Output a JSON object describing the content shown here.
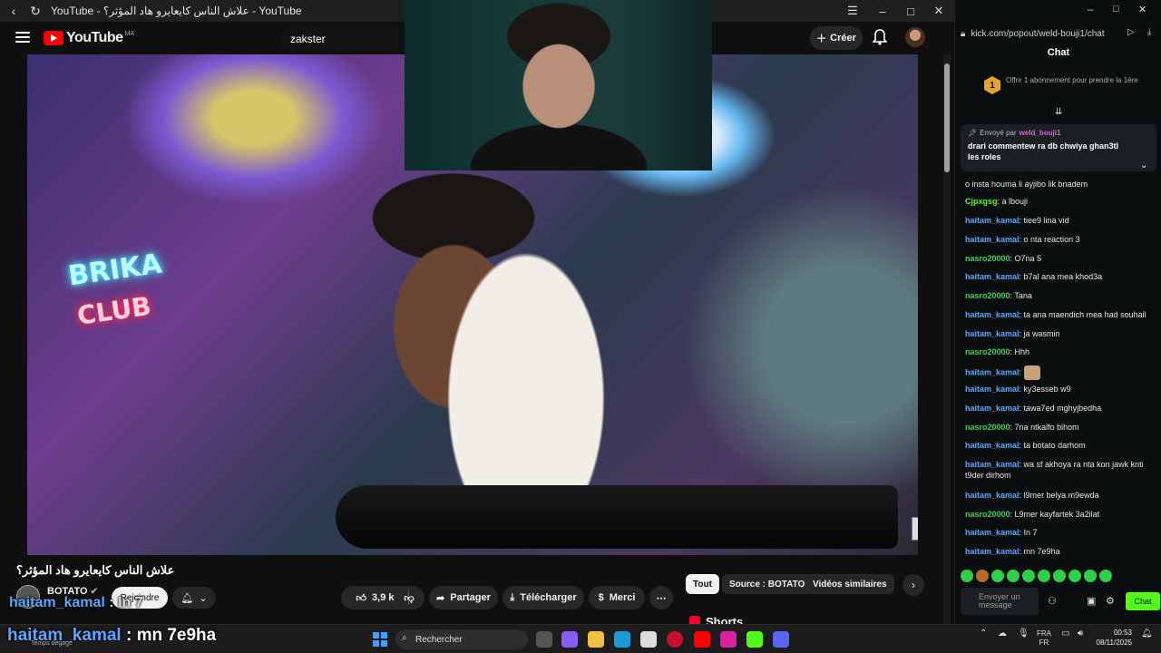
{
  "yt_window": {
    "tab_title": "YouTube - علاش الناس كايعايرو هاد المؤثر؟ - YouTube",
    "logo_text": "YouTube",
    "logo_country": "MA",
    "search_value": "zakster",
    "create_label": "Créer",
    "video_title": "علاش الناس كايعايرو هاد المؤثر؟",
    "channel_name": "BOTATO",
    "join_label": "Rejoindre",
    "likes": "3,9 k",
    "share_label": "Partager",
    "download_label": "Télécharger",
    "thanks_label": "Merci",
    "chips": [
      "Tout",
      "Source : BOTATO",
      "Vidéos similaires"
    ],
    "shorts_label": "Shorts"
  },
  "overlays": {
    "caption_user_small": "haitam_kamal",
    "caption_msg_small": ": In 7",
    "caption_user_large": "haitam_kamal",
    "caption_msg_large": ": mn 7e9ha",
    "temp_label": "Temps dégagé"
  },
  "chat_window": {
    "url": "kick.com/popout/weld-bouji1/chat",
    "header": "Chat",
    "sub_offer_count": "1",
    "sub_offer": "Offrir 1 abonnement pour prendre la 1ère",
    "pinned_by_label": "Envoyé par",
    "pinned_by_user": "weld_bouji1",
    "pinned_message": "drari commentew ra db chwiya ghan3tl les roles",
    "input_placeholder": "Envoyer un message",
    "send_label": "Chat",
    "messages": [
      {
        "user": "",
        "text": "o insta houma li ayjibo lik bnadem",
        "color": "#e6e6e6"
      },
      {
        "user": "Cjpxgsg",
        "text": ": a lbouji",
        "color": "#53fc18"
      },
      {
        "user": "haitam_kamal",
        "text": ": tiee9 lina vid",
        "color": "#5aa7ff"
      },
      {
        "user": "haitam_kamal",
        "text": ": o nta reaction 3",
        "color": "#5aa7ff"
      },
      {
        "user": "nasro20000",
        "text": ": O7na 5",
        "color": "#3ecf5a"
      },
      {
        "user": "haitam_kamal",
        "text": ": b7al ana mea khod3a",
        "color": "#5aa7ff"
      },
      {
        "user": "nasro20000",
        "text": ": Tana",
        "color": "#3ecf5a"
      },
      {
        "user": "haitam_kamal",
        "text": ": ta ana maendich mea had souhail",
        "color": "#5aa7ff"
      },
      {
        "user": "haitam_kamal",
        "text": ": ja wasmin",
        "color": "#5aa7ff"
      },
      {
        "user": "nasro20000",
        "text": ": Hhh",
        "color": "#3ecf5a"
      },
      {
        "user": "haitam_kamal",
        "text": ":",
        "color": "#5aa7ff"
      },
      {
        "user": "haitam_kamal",
        "text": ": ky3esseb w9",
        "color": "#5aa7ff"
      },
      {
        "user": "haitam_kamal",
        "text": ": tawa7ed mghyjbedha",
        "color": "#5aa7ff"
      },
      {
        "user": "nasro20000",
        "text": ": 7na ntkalfo bihom",
        "color": "#3ecf5a"
      },
      {
        "user": "haitam_kamal",
        "text": ": ta botato darhom",
        "color": "#5aa7ff"
      },
      {
        "user": "haitam_kamal",
        "text": ": wa sf akhoya ra nta kon jawk knti t9der dirhom",
        "color": "#5aa7ff"
      },
      {
        "user": "haitam_kamal",
        "text": ": l9mer belya m9ewda",
        "color": "#5aa7ff"
      },
      {
        "user": "nasro20000",
        "text": ": L9mer kayfartek 3a2ilat",
        "color": "#3ecf5a"
      },
      {
        "user": "haitam_kamal",
        "text": ": In 7",
        "color": "#5aa7ff"
      },
      {
        "user": "haitam_kamal",
        "text": ": mn 7e9ha",
        "color": "#5aa7ff"
      }
    ]
  },
  "taskbar": {
    "search_label": "Rechercher",
    "lang_top": "FRA",
    "lang_bottom": "FR",
    "time": "00:53",
    "date": "08/11/2025"
  },
  "colors": {
    "yt_red": "#ff0000",
    "kick_green": "#53fc18",
    "chat_user_blue": "#5aa7ff",
    "chat_user_green": "#3ecf5a"
  }
}
